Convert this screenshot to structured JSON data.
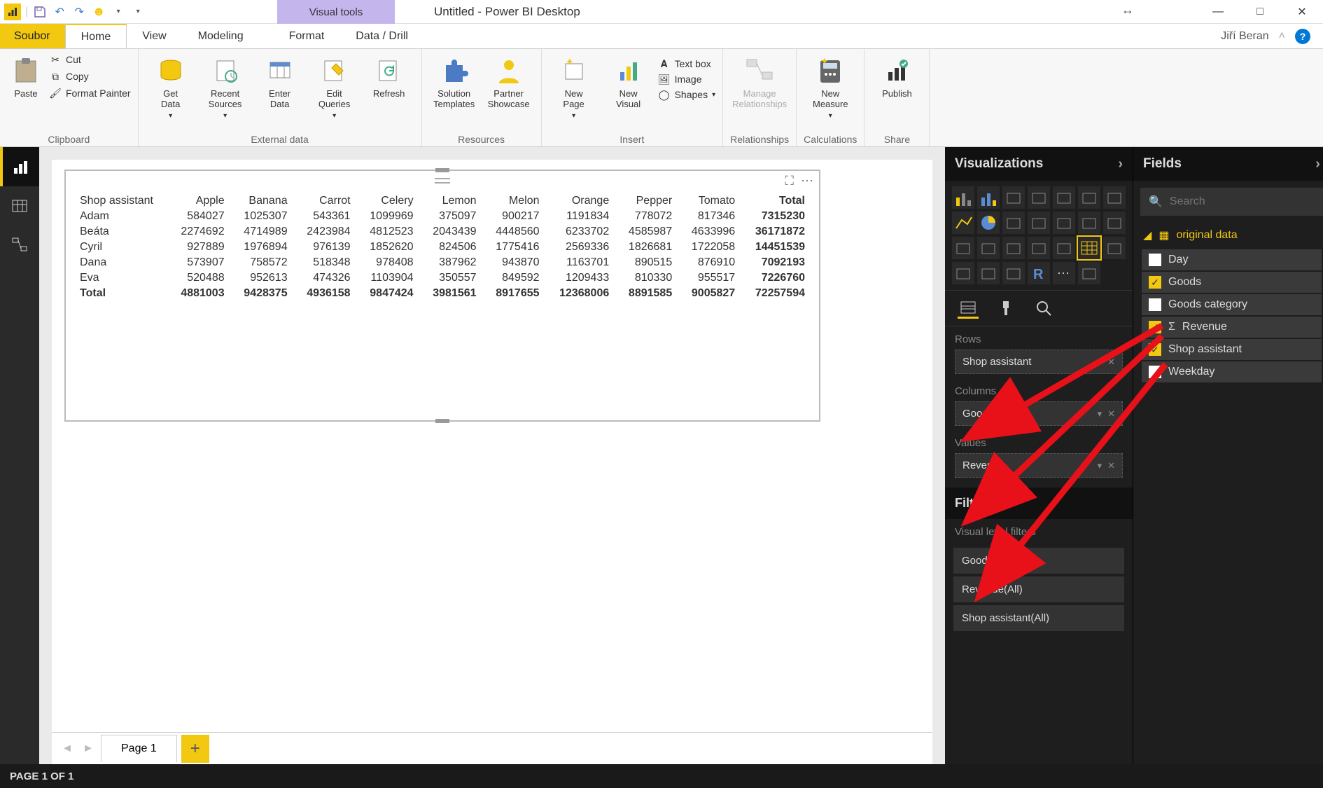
{
  "titlebar": {
    "visual_tools": "Visual tools",
    "title": "Untitled - Power BI Desktop"
  },
  "user": {
    "name": "Jiří Beran"
  },
  "tabs": {
    "file": "Soubor",
    "home": "Home",
    "view": "View",
    "modeling": "Modeling",
    "format": "Format",
    "data_drill": "Data / Drill"
  },
  "ribbon": {
    "clipboard": {
      "label": "Clipboard",
      "paste": "Paste",
      "cut": "Cut",
      "copy": "Copy",
      "format_painter": "Format Painter"
    },
    "external": {
      "label": "External data",
      "get_data": "Get\nData",
      "recent": "Recent\nSources",
      "enter": "Enter\nData",
      "edit": "Edit\nQueries",
      "refresh": "Refresh"
    },
    "resources": {
      "label": "Resources",
      "solution": "Solution\nTemplates",
      "partner": "Partner\nShowcase"
    },
    "insert": {
      "label": "Insert",
      "new_page": "New\nPage",
      "new_visual": "New\nVisual",
      "text_box": "Text box",
      "image": "Image",
      "shapes": "Shapes"
    },
    "relationships": {
      "label": "Relationships",
      "manage": "Manage\nRelationships"
    },
    "calculations": {
      "label": "Calculations",
      "measure": "New\nMeasure"
    },
    "share": {
      "label": "Share",
      "publish": "Publish"
    }
  },
  "chart_data": {
    "type": "table",
    "row_field": "Shop assistant",
    "columns": [
      "Apple",
      "Banana",
      "Carrot",
      "Celery",
      "Lemon",
      "Melon",
      "Orange",
      "Pepper",
      "Tomato",
      "Total"
    ],
    "rows": [
      {
        "name": "Adam",
        "values": [
          584027,
          1025307,
          543361,
          1099969,
          375097,
          900217,
          1191834,
          778072,
          817346,
          7315230
        ]
      },
      {
        "name": "Beáta",
        "values": [
          2274692,
          4714989,
          2423984,
          4812523,
          2043439,
          4448560,
          6233702,
          4585987,
          4633996,
          36171872
        ]
      },
      {
        "name": "Cyril",
        "values": [
          927889,
          1976894,
          976139,
          1852620,
          824506,
          1775416,
          2569336,
          1826681,
          1722058,
          14451539
        ]
      },
      {
        "name": "Dana",
        "values": [
          573907,
          758572,
          518348,
          978408,
          387962,
          943870,
          1163701,
          890515,
          876910,
          7092193
        ]
      },
      {
        "name": "Eva",
        "values": [
          520488,
          952613,
          474326,
          1103904,
          350557,
          849592,
          1209433,
          810330,
          955517,
          7226760
        ]
      }
    ],
    "totals": {
      "name": "Total",
      "values": [
        4881003,
        9428375,
        4936158,
        9847424,
        3981561,
        8917655,
        12368006,
        8891585,
        9005827,
        72257594
      ]
    }
  },
  "pages": {
    "page1": "Page 1"
  },
  "status": "PAGE 1 OF 1",
  "viz_panel": {
    "title": "Visualizations",
    "rows": "Rows",
    "rows_item": "Shop assistant",
    "columns": "Columns",
    "columns_item": "Goods",
    "values": "Values",
    "values_item": "Revenue",
    "filters": "Filters",
    "filter_sub": "Visual level filters",
    "filter_items": [
      "Goods(All)",
      "Revenue(All)",
      "Shop assistant(All)"
    ]
  },
  "fields_panel": {
    "title": "Fields",
    "search_placeholder": "Search",
    "table": "original data",
    "fields": [
      {
        "name": "Day",
        "checked": false,
        "sigma": false
      },
      {
        "name": "Goods",
        "checked": true,
        "sigma": false
      },
      {
        "name": "Goods category",
        "checked": false,
        "sigma": false
      },
      {
        "name": "Revenue",
        "checked": true,
        "sigma": true
      },
      {
        "name": "Shop assistant",
        "checked": true,
        "sigma": false
      },
      {
        "name": "Weekday",
        "checked": false,
        "sigma": false
      }
    ]
  }
}
